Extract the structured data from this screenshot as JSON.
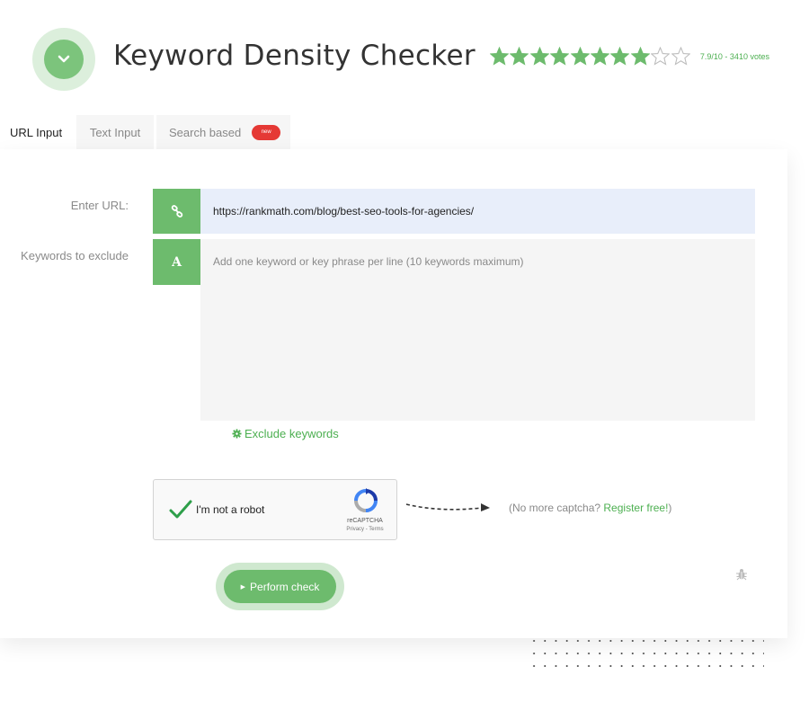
{
  "header": {
    "title": "Keyword Density Checker",
    "logo_icon": "chevron-down-icon",
    "rating": {
      "stars_total": 10,
      "stars_filled": 8,
      "text": "7.9/10 - 3410 votes"
    }
  },
  "tabs": [
    {
      "label": "URL Input",
      "active": true
    },
    {
      "label": "Text Input",
      "active": false
    },
    {
      "label": "Search based",
      "active": false,
      "badge": "new"
    }
  ],
  "form": {
    "url_label": "Enter URL:",
    "url_icon": "link-icon",
    "url_value": "https://rankmath.com/blog/best-seo-tools-for-agencies/",
    "keywords_label": "Keywords to exclude",
    "keywords_icon": "letter-a-icon",
    "keywords_icon_text": "A",
    "keywords_placeholder": "Add one keyword or key phrase per line (10 keywords maximum)",
    "exclude_link": "Exclude keywords"
  },
  "captcha": {
    "label": "I'm not a robot",
    "brand": "reCAPTCHA",
    "links": "Privacy - Terms",
    "note_prefix": "(No more captcha? ",
    "register_link": "Register free!",
    "note_suffix": ")"
  },
  "actions": {
    "perform_label": "Perform check"
  },
  "colors": {
    "accent": "#6dbb6d",
    "accent_light": "#dcefdc",
    "badge": "#e53935",
    "url_bg": "#e8eefa"
  }
}
